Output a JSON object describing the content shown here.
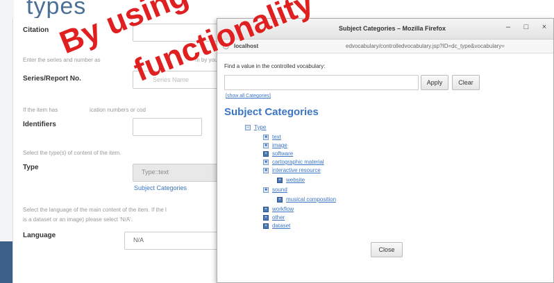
{
  "background": {
    "header_word": "types"
  },
  "form": {
    "citation_label": "Citation",
    "series_help": "Enter the series and number as",
    "series_help_tail": "m by your",
    "series_label": "Series/Report No.",
    "series_placeholder": "Series Name",
    "identifiers_help_head": "If the item has",
    "identifiers_help": "ication numbers or cod",
    "identifiers_label": "Identifiers",
    "type_help": "Select the type(s) of content of the item.",
    "type_label": "Type",
    "type_value": "Type::text",
    "subject_categories_link": "Subject Categories",
    "language_help": "Select the language of the main content of the item. If the l",
    "language_help2": "is a dataset or an image) please select 'N/A'.",
    "language_label": "Language",
    "language_value": "N/A"
  },
  "popup": {
    "title": "Subject Categories – Mozilla Firefox",
    "controls": {
      "minimize": "–",
      "maximize": "□",
      "close": "×"
    },
    "url_host": "localhost",
    "url_path": "edvocabulary/controlledvocabulary.jsp?ID=dc_type&vocabulary=",
    "find_label": "Find a value in the controlled vocabulary:",
    "apply_label": "Apply",
    "clear_label": "Clear",
    "show_all_link": "[show all Categories]",
    "heading": "Subject Categories",
    "tree": [
      {
        "label": "Type",
        "marker": "−",
        "leaf": false
      },
      {
        "label": "text",
        "marker": "■",
        "leaf": false
      },
      {
        "label": "image",
        "marker": "■",
        "leaf": false
      },
      {
        "label": "software",
        "marker": "+",
        "leaf": true
      },
      {
        "label": "cartographic material",
        "marker": "■",
        "leaf": false
      },
      {
        "label": "interactive resource",
        "marker": "■",
        "leaf": false
      },
      {
        "label": "website",
        "marker": "+",
        "leaf": true
      },
      {
        "label": "sound",
        "marker": "■",
        "leaf": false
      },
      {
        "label": "musical composition",
        "marker": "+",
        "leaf": true
      },
      {
        "label": "workflow",
        "marker": "+",
        "leaf": true
      },
      {
        "label": "other",
        "marker": "+",
        "leaf": true
      },
      {
        "label": "dataset",
        "marker": "+",
        "leaf": true
      }
    ],
    "close_label": "Close"
  },
  "watermark": {
    "line1": "By using se",
    "line2": "functionality"
  },
  "colors": {
    "link": "#3a75c4",
    "watermark": "#e02020",
    "accent_blue": "#3b5f88"
  }
}
